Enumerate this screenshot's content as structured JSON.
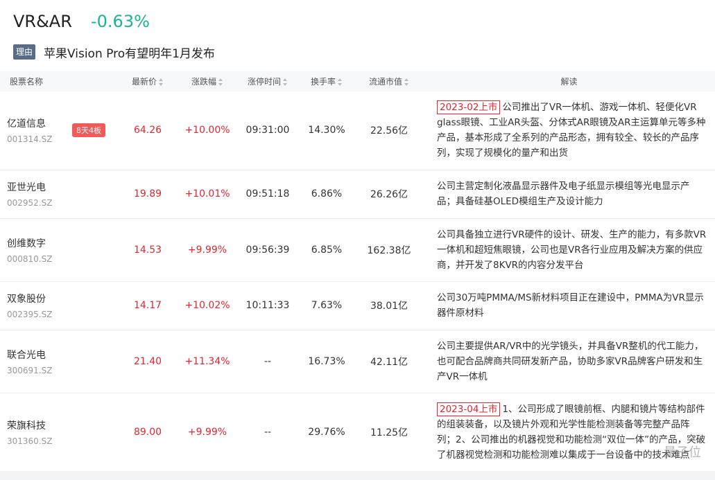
{
  "header": {
    "title": "VR&AR",
    "change": "-0.63%",
    "reason_badge": "理由",
    "reason_text": "苹果Vision Pro有望明年1月发布"
  },
  "table": {
    "columns": [
      "股票名称",
      "最新价",
      "涨跌幅",
      "涨停时间",
      "换手率",
      "流通市值",
      "解读"
    ],
    "rows": [
      {
        "name": "亿道信息",
        "code": "001314.SZ",
        "tag": "8天4板",
        "price": "64.26",
        "change": "+10.00%",
        "limit_time": "09:31:00",
        "turnover": "14.30%",
        "market_cap": "22.56亿",
        "date_tag": "2023-02上市",
        "desc": "公司推出了VR一体机、游戏一体机、轻便化VR glass眼镜、工业AR头盔、分体式AR眼镜及AR主运算单元等多种产品，基本形成了全系列的产品形态，拥有较全、较长的产品序列，实现了规模化的量产和出货"
      },
      {
        "name": "亚世光电",
        "code": "002952.SZ",
        "tag": "",
        "price": "19.89",
        "change": "+10.01%",
        "limit_time": "09:51:18",
        "turnover": "6.86%",
        "market_cap": "26.26亿",
        "date_tag": "",
        "desc": "公司主营定制化液晶显示器件及电子纸显示模组等光电显示产品；具备硅基OLED模组生产及设计能力"
      },
      {
        "name": "创维数字",
        "code": "000810.SZ",
        "tag": "",
        "price": "14.53",
        "change": "+9.99%",
        "limit_time": "09:56:39",
        "turnover": "6.85%",
        "market_cap": "162.38亿",
        "date_tag": "",
        "desc": "公司具备独立进行VR硬件的设计、研发、生产的能力，有多款VR一体机和超短焦眼镜，公司也是VR各行业应用及解决方案的供应商，并开发了8KVR的内容分发平台"
      },
      {
        "name": "双象股份",
        "code": "002395.SZ",
        "tag": "",
        "price": "14.17",
        "change": "+10.02%",
        "limit_time": "10:11:33",
        "turnover": "7.63%",
        "market_cap": "38.01亿",
        "date_tag": "",
        "desc": "公司30万吨PMMA/MS新材料项目正在建设中，PMMA为VR显示器件原材料"
      },
      {
        "name": "联合光电",
        "code": "300691.SZ",
        "tag": "",
        "price": "21.40",
        "change": "+11.34%",
        "limit_time": "--",
        "turnover": "16.73%",
        "market_cap": "42.11亿",
        "date_tag": "",
        "desc": "公司主要提供AR/VR中的光学镜头，并具备VR整机的代工能力，也可配合品牌商共同研发新产品，协助多家VR品牌客户研发和生产VR一体机"
      },
      {
        "name": "荣旗科技",
        "code": "301360.SZ",
        "tag": "",
        "price": "89.00",
        "change": "+9.99%",
        "limit_time": "--",
        "turnover": "29.76%",
        "market_cap": "11.25亿",
        "date_tag": "2023-04上市",
        "desc": "1、公司形成了眼镜前框、内腿和镜片等结构部件的组装装备，以及镜片外观和光学性能检测装备等完整产品阵列；2、公司推出的机器视觉和功能检测“双位一体”的产品，突破了机器视觉检测和功能检测难以集成于一台设备中的技术难点"
      }
    ]
  },
  "watermark": "量子位",
  "colors": {
    "up": "#e0262f",
    "down": "#1bb394",
    "tag_bg": "#f25a5a",
    "badge_bg": "#5a6b84"
  }
}
